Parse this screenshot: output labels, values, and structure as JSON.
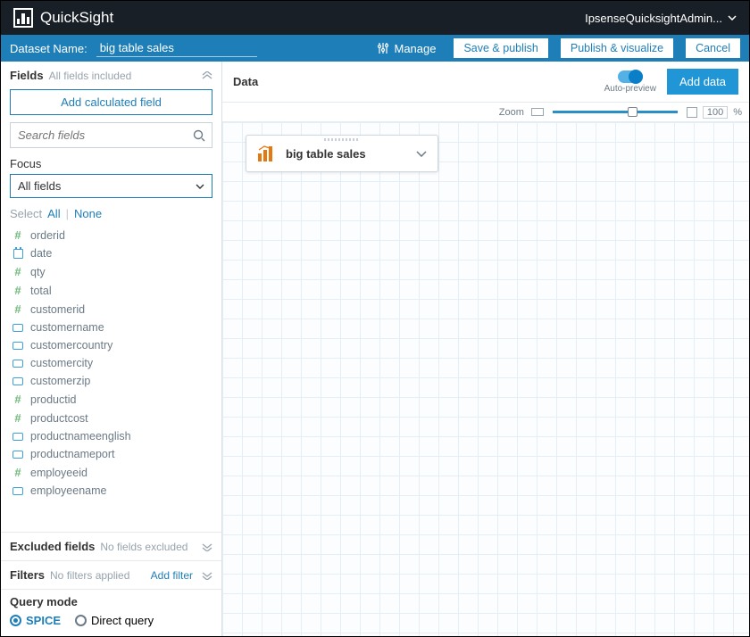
{
  "brand": {
    "name": "QuickSight"
  },
  "user": {
    "name": "IpsenseQuicksightAdmin..."
  },
  "dsbar": {
    "label": "Dataset Name:",
    "value": "big table sales",
    "manage": "Manage",
    "save_publish": "Save & publish",
    "publish_visualize": "Publish & visualize",
    "cancel": "Cancel"
  },
  "fields_panel": {
    "title": "Fields",
    "subtitle": "All fields included",
    "add_calc": "Add calculated field",
    "search_placeholder": "Search fields",
    "focus_label": "Focus",
    "focus_value": "All fields",
    "select_label": "Select",
    "all": "All",
    "none": "None",
    "fields": [
      {
        "name": "orderid",
        "type": "number"
      },
      {
        "name": "date",
        "type": "date"
      },
      {
        "name": "qty",
        "type": "number"
      },
      {
        "name": "total",
        "type": "number"
      },
      {
        "name": "customerid",
        "type": "number"
      },
      {
        "name": "customername",
        "type": "string"
      },
      {
        "name": "customercountry",
        "type": "string"
      },
      {
        "name": "customercity",
        "type": "string"
      },
      {
        "name": "customerzip",
        "type": "string"
      },
      {
        "name": "productid",
        "type": "number"
      },
      {
        "name": "productcost",
        "type": "number"
      },
      {
        "name": "productnameenglish",
        "type": "string"
      },
      {
        "name": "productnameport",
        "type": "string"
      },
      {
        "name": "employeeid",
        "type": "number"
      },
      {
        "name": "employeename",
        "type": "string"
      }
    ]
  },
  "excluded": {
    "title": "Excluded fields",
    "subtitle": "No fields excluded"
  },
  "filters": {
    "title": "Filters",
    "subtitle": "No filters applied",
    "add": "Add filter"
  },
  "query_mode": {
    "title": "Query mode",
    "spice": "SPICE",
    "direct": "Direct query",
    "selected": "spice"
  },
  "data_panel": {
    "title": "Data",
    "auto_preview": "Auto-preview",
    "add_data": "Add data",
    "zoom_label": "Zoom",
    "zoom_pct": "100",
    "zoom_unit": "%"
  },
  "node": {
    "label": "big table sales"
  }
}
